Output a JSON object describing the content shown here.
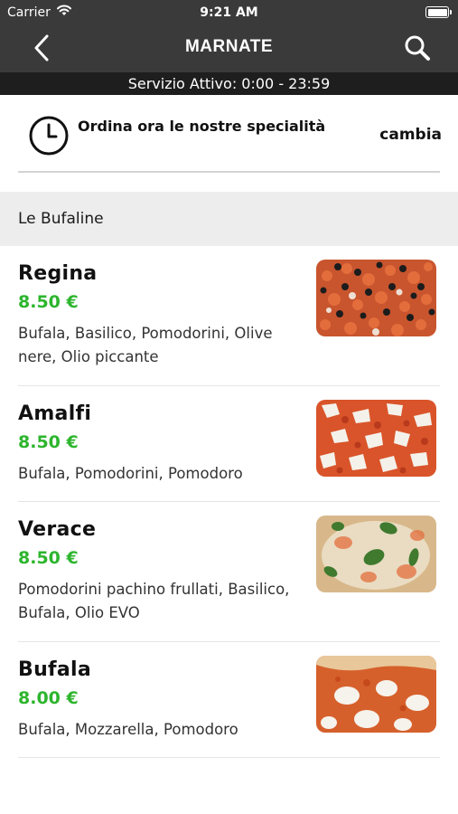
{
  "status_bar": {
    "carrier": "Carrier",
    "time": "9:21 AM"
  },
  "nav": {
    "title": "MARNATE",
    "back_icon": "chevron-left-icon",
    "search_icon": "search-icon"
  },
  "service": {
    "text": "Servizio Attivo: 0:00 - 23:59"
  },
  "order": {
    "label": "Ordina ora le nostre specialità",
    "change_label": "cambia",
    "icon": "clock-icon"
  },
  "category": {
    "title": "Le Bufaline"
  },
  "colors": {
    "nav_bg": "#3a3a3a",
    "service_bg": "#1e1e1e",
    "price_green": "#2db52d",
    "category_bg": "#ededed"
  },
  "items": [
    {
      "name": "Regina",
      "price": "8.50 €",
      "description": "Bufala, Basilico, Pomodorini, Olive nere, Olio piccante",
      "image": "pizza-photo"
    },
    {
      "name": "Amalfi",
      "price": "8.50 €",
      "description": "Bufala, Pomodorini, Pomodoro",
      "image": "pizza-photo"
    },
    {
      "name": "Verace",
      "price": "8.50 €",
      "description": "Pomodorini pachino frullati, Basilico, Bufala, Olio EVO",
      "image": "pizza-photo"
    },
    {
      "name": "Bufala",
      "price": "8.00 €",
      "description": "Bufala, Mozzarella, Pomodoro",
      "image": "pizza-photo"
    }
  ]
}
